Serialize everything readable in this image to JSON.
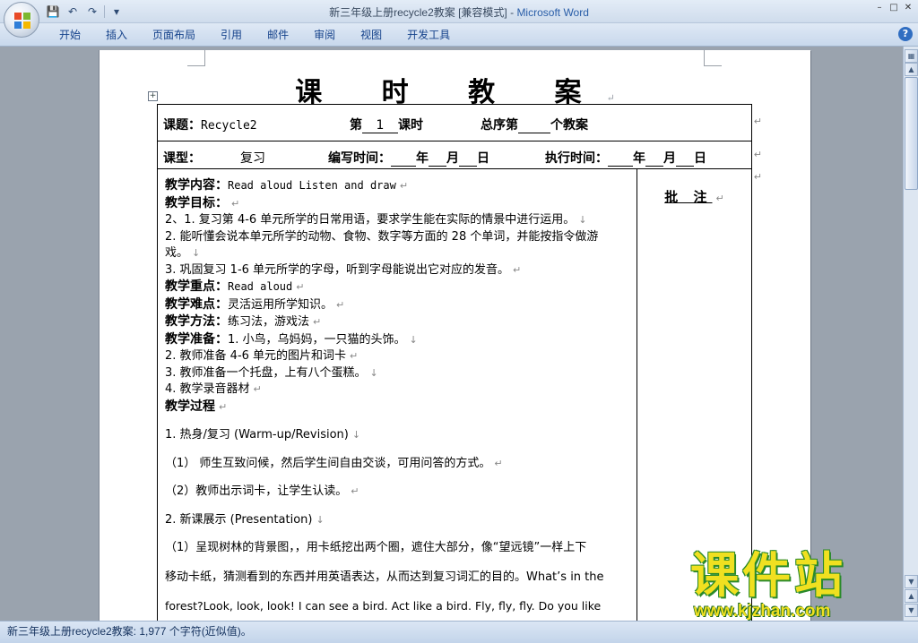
{
  "window": {
    "doc_name": "新三年级上册recycle2教案 [兼容模式]",
    "separator": " - ",
    "app_name": "Microsoft Word"
  },
  "ribbon": {
    "tabs": [
      "开始",
      "插入",
      "页面布局",
      "引用",
      "邮件",
      "审阅",
      "视图",
      "开发工具"
    ]
  },
  "document": {
    "title": "课 时 教 案",
    "row1": {
      "topic_label": "课题：",
      "topic_value": "Recycle2",
      "lesson_prefix": "第",
      "lesson_num": "1",
      "lesson_suffix": "课时",
      "total_prefix": "总序第",
      "total_suffix": "个教案"
    },
    "row2": {
      "type_label": "课型：",
      "type_value": "复习",
      "write_time_label": "编写时间：",
      "exec_time_label": "执行时间：",
      "year": "年",
      "month": "月",
      "day": "日"
    },
    "note_title": "批 注",
    "content": {
      "l1_label": "教学内容：",
      "l1_text": "Read aloud  Listen and draw",
      "l2_label": "教学目标：",
      "l3": "2、1. 复习第 4-6 单元所学的日常用语，要求学生能在实际的情景中进行运用。",
      "l4": "2. 能听懂会说本单元所学的动物、食物、数字等方面的 28 个单词，并能按指令做游",
      "l5": "戏。",
      "l6": "3. 巩固复习 1-6 单元所学的字母，听到字母能说出它对应的发音。",
      "l7_label": "教学重点：",
      "l7_text": "Read aloud",
      "l8_label": "教学难点：",
      "l8_text": "灵活运用所学知识。",
      "l9_label": "教学方法：",
      "l9_text": "练习法，游戏法",
      "l10_label": "教学准备：",
      "l10_text": "1. 小鸟，乌妈妈，一只猫的头饰。",
      "l11": "2.  教师准备 4-6 单元的图片和词卡",
      "l12": "3.  教师准备一个托盘，上有八个蛋糕。",
      "l13": "4.  教学录音器材",
      "l14_label": "教学过程",
      "l15": "1.  热身/复习 (Warm-up/Revision)",
      "l16": "（1）  师生互致问候，然后学生间自由交谈，可用问答的方式。",
      "l17": "（2）教师出示词卡，让学生认读。",
      "l18": "2.  新课展示 (Presentation)",
      "l19": "（1）呈现树林的背景图，，用卡纸挖出两个圈，遮住大部分，像“望远镜”一样上下",
      "l20": "移动卡纸，猜测看到的东西并用英语表达，从而达到复习词汇的目的。What’s in the",
      "l21": "forest?Look, look, look! I can see a bird. Act like a bird. Fly, fly, fly. Do you like"
    }
  },
  "status_bar": {
    "text": "新三年级上册recycle2教案: 1,977 个字符(近似值)。"
  },
  "watermark": {
    "big": "课件站",
    "url": "www.kjzhan.com"
  }
}
